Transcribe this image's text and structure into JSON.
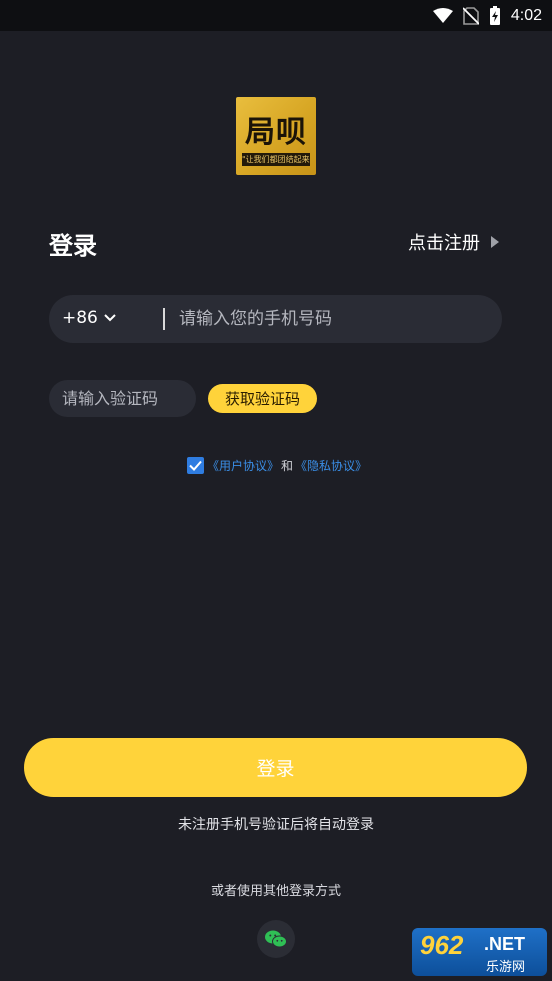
{
  "status_bar": {
    "time": "4:02"
  },
  "logo": {
    "main_text": "局呗",
    "slogan": "\"让我们都团结起来\""
  },
  "header": {
    "title": "登录",
    "register_link": "点击注册"
  },
  "phone": {
    "country_code": "+86",
    "placeholder": "请输入您的手机号码"
  },
  "code": {
    "placeholder": "请输入验证码",
    "get_code_label": "获取验证码"
  },
  "agreement": {
    "checked": true,
    "user_agreement": "《用户协议》",
    "and": "和",
    "privacy_agreement": "《隐私协议》"
  },
  "login_button": "登录",
  "auto_register_note": "未注册手机号验证后将自动登录",
  "other_login": "或者使用其他登录方式",
  "watermark": {
    "top": "962",
    "net": ".NET",
    "bottom": "乐游网"
  },
  "colors": {
    "background": "#1d1e25",
    "accent": "#ffd33a",
    "input_bg": "#2a2c35",
    "link": "#3a8ee6"
  }
}
